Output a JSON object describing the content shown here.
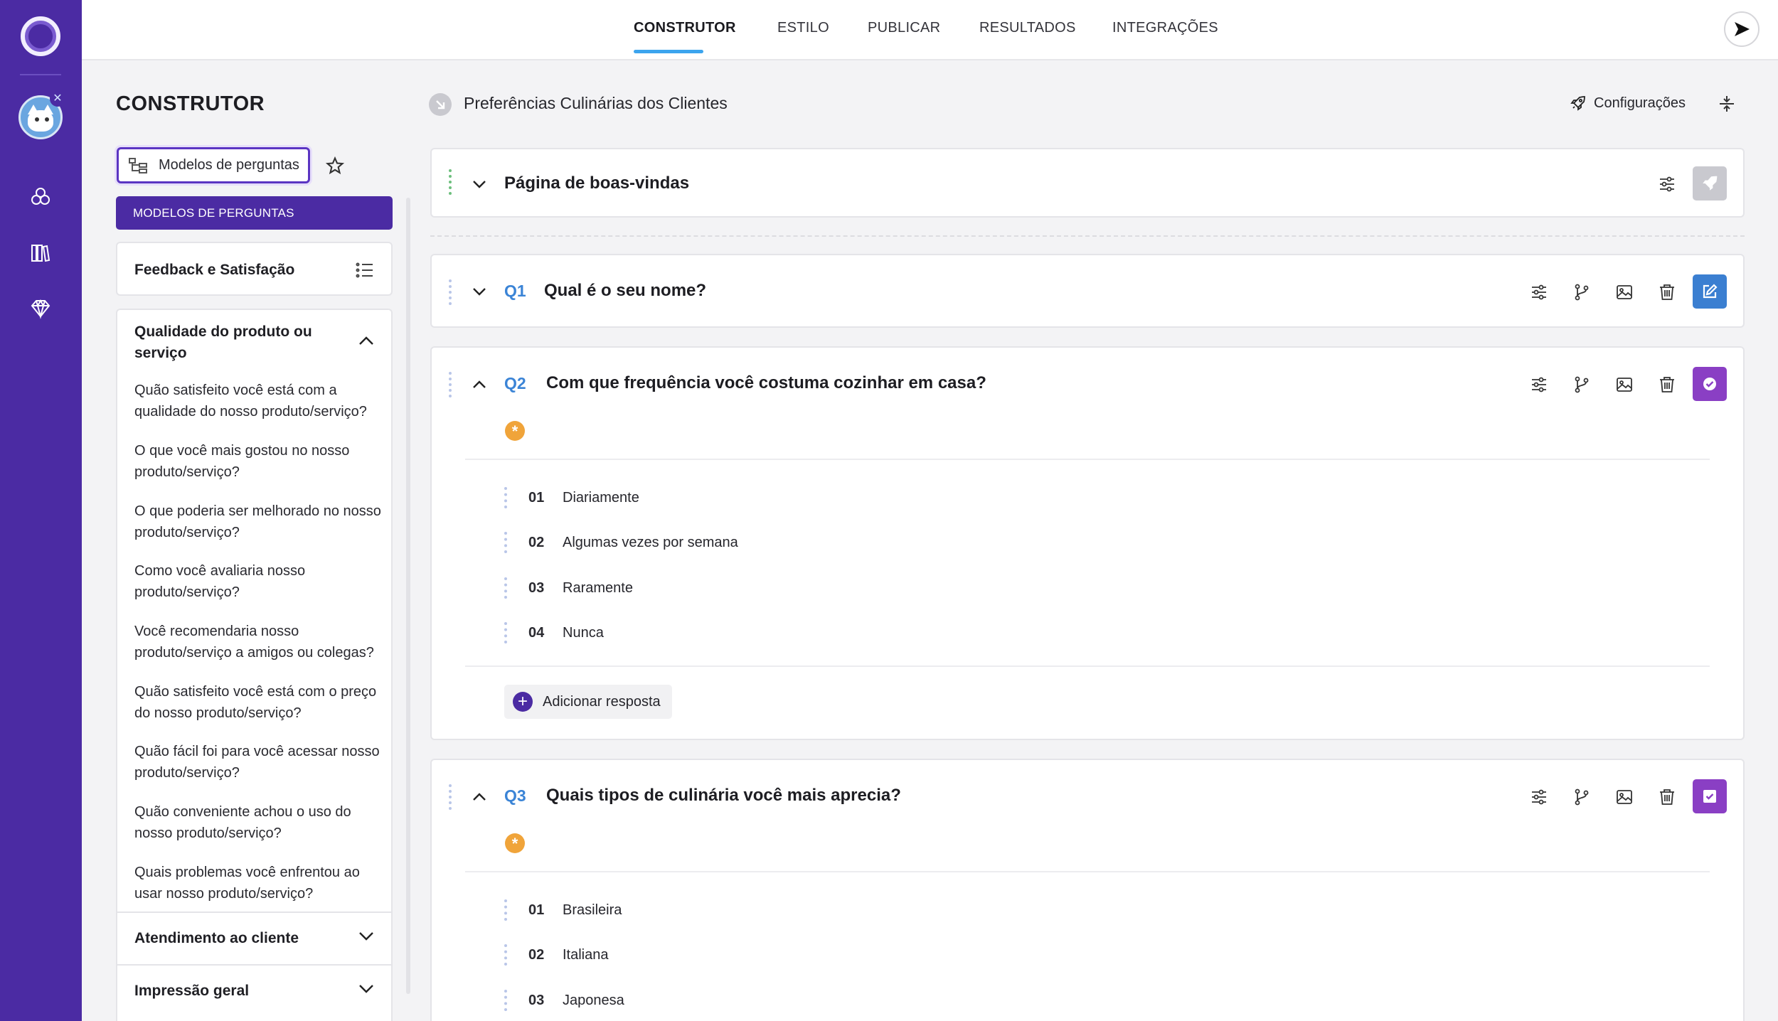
{
  "tabs": [
    {
      "label": "CONSTRUTOR",
      "active": true
    },
    {
      "label": "ESTILO",
      "active": false
    },
    {
      "label": "PUBLICAR",
      "active": false
    },
    {
      "label": "RESULTADOS",
      "active": false
    },
    {
      "label": "INTEGRAÇÕES",
      "active": false
    }
  ],
  "panel": {
    "title": "CONSTRUTOR",
    "models_button": "Modelos de perguntas",
    "models_bar": "MODELOS DE PERGUNTAS",
    "feedback_title": "Feedback e Satisfação",
    "category_open": "Qualidade do produto ou serviço",
    "templates": [
      "Quão satisfeito você está com a qualidade do nosso produto/serviço?",
      "O que você mais gostou no nosso produto/serviço?",
      "O que poderia ser melhorado no nosso produto/serviço?",
      "Como você avaliaria nosso produto/serviço?",
      "Você recomendaria nosso produto/serviço a amigos ou colegas?",
      "Quão satisfeito você está com o preço do nosso produto/serviço?",
      "Quão fácil foi para você acessar nosso produto/serviço?",
      "Quão conveniente achou o uso do nosso produto/serviço?",
      "Quais problemas você enfrentou ao usar nosso produto/serviço?"
    ],
    "categories_closed": [
      "Atendimento ao cliente",
      "Impressão geral"
    ]
  },
  "survey": {
    "title": "Preferências Culinárias dos Clientes",
    "config_label": "Configurações",
    "welcome": "Página de boas-vindas"
  },
  "questions": [
    {
      "num": "Q1",
      "text": "Qual é o seu nome?",
      "action_color": "#3b7fd1"
    },
    {
      "num": "Q2",
      "text": "Com que frequência você costuma cozinhar em casa?",
      "action_color": "#8a3fc4",
      "answers": [
        {
          "n": "01",
          "l": "Diariamente"
        },
        {
          "n": "02",
          "l": "Algumas vezes por semana"
        },
        {
          "n": "03",
          "l": "Raramente"
        },
        {
          "n": "04",
          "l": "Nunca"
        }
      ],
      "add_label": "Adicionar resposta"
    },
    {
      "num": "Q3",
      "text": "Quais tipos de culinária você mais aprecia?",
      "action_color": "#8a3fc4",
      "answers": [
        {
          "n": "01",
          "l": "Brasileira"
        },
        {
          "n": "02",
          "l": "Italiana"
        },
        {
          "n": "03",
          "l": "Japonesa"
        }
      ]
    }
  ],
  "icons": {
    "required": "*"
  }
}
